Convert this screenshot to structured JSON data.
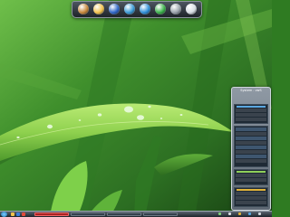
{
  "desktop": {
    "wallpaper": "grass-blade-with-water-drops",
    "colors": {
      "grass_dark": "#1f5a19",
      "grass_mid": "#3f8f2c",
      "grass_light": "#9ad35b"
    }
  },
  "dock": {
    "items": [
      {
        "icon": "clock-icon",
        "color": "#c8873b"
      },
      {
        "icon": "folder-icon",
        "color": "#f2c24b"
      },
      {
        "icon": "network-icon",
        "color": "#2f66c8"
      },
      {
        "icon": "camera-icon",
        "color": "#3a9ad6"
      },
      {
        "icon": "globe-icon",
        "color": "#2f8fd8"
      },
      {
        "icon": "media-player-icon",
        "color": "#3bb24a"
      },
      {
        "icon": "settings-icon",
        "color": "#9aa2ab"
      },
      {
        "icon": "drive-icon",
        "color": "#d7dde3"
      }
    ]
  },
  "system_monitor": {
    "title": "System . vwS"
  },
  "taskbar": {
    "start_icon": "windows-orb-icon",
    "quick_launch": [
      {
        "icon": "explorer-icon",
        "color": "#f1c24a"
      },
      {
        "icon": "browser-icon",
        "color": "#3b7fd9"
      },
      {
        "icon": "media-icon",
        "color": "#e04a3a"
      }
    ],
    "tray_icons": [
      {
        "icon": "network-tray-icon",
        "color": "#7fd07a"
      },
      {
        "icon": "volume-tray-icon",
        "color": "#d9dde2"
      },
      {
        "icon": "security-tray-icon",
        "color": "#e0b33a"
      },
      {
        "icon": "update-tray-icon",
        "color": "#5aa7e0"
      },
      {
        "icon": "clock-tray-icon",
        "color": "#cfd6dd"
      }
    ]
  }
}
